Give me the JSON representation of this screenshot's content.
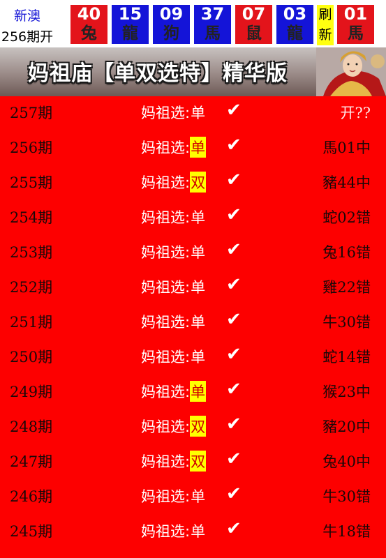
{
  "header": {
    "label_region": "新澳",
    "label_period": "256期开",
    "refresh_label": "刷新",
    "balls": [
      {
        "num": "40",
        "zodiac": "兔",
        "color": "#e3141b"
      },
      {
        "num": "15",
        "zodiac": "龍",
        "color": "#1414d8"
      },
      {
        "num": "09",
        "zodiac": "狗",
        "color": "#1414d8"
      },
      {
        "num": "37",
        "zodiac": "馬",
        "color": "#1414d8"
      },
      {
        "num": "07",
        "zodiac": "鼠",
        "color": "#e3141b"
      },
      {
        "num": "03",
        "zodiac": "龍",
        "color": "#1414d8"
      },
      {
        "num": "01",
        "zodiac": "馬",
        "color": "#e3141b"
      }
    ]
  },
  "banner": {
    "title": "妈祖庙【单双选特】精华版"
  },
  "list": {
    "rows": [
      {
        "period": "257期",
        "prefix": "妈祖选:",
        "pick": "单",
        "highlight": false,
        "result": "开??"
      },
      {
        "period": "256期",
        "prefix": "妈祖选:",
        "pick": "单",
        "highlight": true,
        "result": "馬01中"
      },
      {
        "period": "255期",
        "prefix": "妈祖选:",
        "pick": "双",
        "highlight": true,
        "result": "豬44中"
      },
      {
        "period": "254期",
        "prefix": "妈祖选:",
        "pick": "单",
        "highlight": false,
        "result": "蛇02错"
      },
      {
        "period": "253期",
        "prefix": "妈祖选:",
        "pick": "单",
        "highlight": false,
        "result": "兔16错"
      },
      {
        "period": "252期",
        "prefix": "妈祖选:",
        "pick": "单",
        "highlight": false,
        "result": "雞22错"
      },
      {
        "period": "251期",
        "prefix": "妈祖选:",
        "pick": "单",
        "highlight": false,
        "result": "牛30错"
      },
      {
        "period": "250期",
        "prefix": "妈祖选:",
        "pick": "单",
        "highlight": false,
        "result": "蛇14错"
      },
      {
        "period": "249期",
        "prefix": "妈祖选:",
        "pick": "单",
        "highlight": true,
        "result": "猴23中"
      },
      {
        "period": "248期",
        "prefix": "妈祖选:",
        "pick": "双",
        "highlight": true,
        "result": "豬20中"
      },
      {
        "period": "247期",
        "prefix": "妈祖选:",
        "pick": "双",
        "highlight": true,
        "result": "兔40中"
      },
      {
        "period": "246期",
        "prefix": "妈祖选:",
        "pick": "单",
        "highlight": false,
        "result": "牛30错"
      },
      {
        "period": "245期",
        "prefix": "妈祖选:",
        "pick": "单",
        "highlight": false,
        "result": "牛18错"
      }
    ],
    "check_mark": "✔"
  }
}
